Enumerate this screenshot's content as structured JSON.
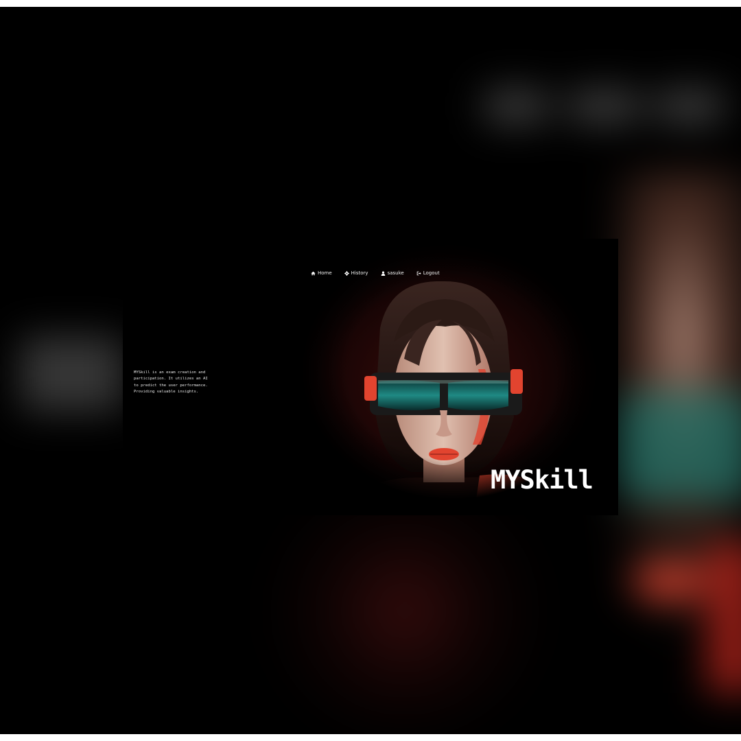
{
  "nav": {
    "items": [
      {
        "label": "Home",
        "icon": "home-icon"
      },
      {
        "label": "History",
        "icon": "gear-icon"
      },
      {
        "label": "sasuke",
        "icon": "user-icon"
      },
      {
        "label": "Logout",
        "icon": "logout-icon"
      }
    ]
  },
  "description": "MYSkill is an exam creation and participation. It utilizes an AI to predict the user performance. Providing valuable insights.",
  "brand": {
    "logo_text": "MYSkill"
  },
  "colors": {
    "background": "#000000",
    "accent_red": "#e2442f",
    "accent_teal": "#1f8a84",
    "text": "#ffffff"
  }
}
